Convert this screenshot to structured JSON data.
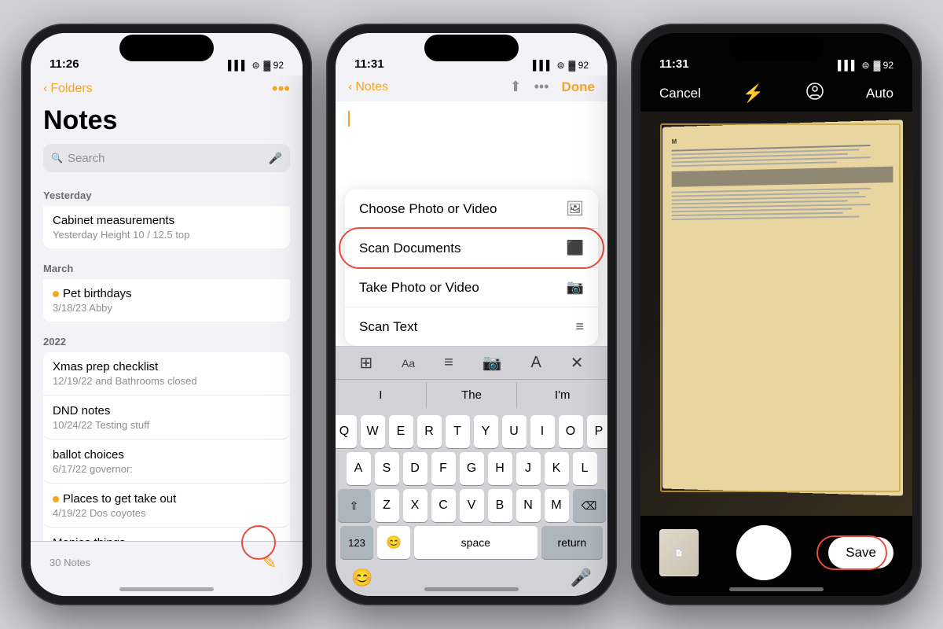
{
  "phone1": {
    "status": {
      "time": "11:26",
      "signal": "▌▌▌",
      "wifi": "WiFi",
      "battery": "92"
    },
    "nav": {
      "back_label": "Folders",
      "more_icon": "•••"
    },
    "title": "Notes",
    "search": {
      "placeholder": "Search"
    },
    "sections": [
      {
        "header": "Yesterday",
        "notes": [
          {
            "title": "Cabinet measurements",
            "subtitle": "Yesterday  Height 10 / 12.5 top",
            "shared": false
          }
        ]
      },
      {
        "header": "March",
        "notes": [
          {
            "title": "Pet birthdays",
            "subtitle": "3/18/23  Abby",
            "shared": true
          }
        ]
      },
      {
        "header": "2022",
        "notes": [
          {
            "title": "Xmas prep checklist",
            "subtitle": "12/19/22  and Bathrooms closed",
            "shared": false
          },
          {
            "title": "DND notes",
            "subtitle": "10/24/22  Testing stuff",
            "shared": false
          },
          {
            "title": "ballot choices",
            "subtitle": "6/17/22  governor:",
            "shared": false
          },
          {
            "title": "Places to get take out",
            "subtitle": "4/19/22  Dos coyotes",
            "shared": true
          },
          {
            "title": "Monies things",
            "subtitle": "",
            "shared": false
          }
        ]
      }
    ],
    "footer": {
      "count": "30 Notes",
      "compose_icon": "✏"
    }
  },
  "phone2": {
    "status": {
      "time": "11:31",
      "signal": "▌▌▌",
      "wifi": "WiFi",
      "battery": "92"
    },
    "nav": {
      "back_label": "Notes",
      "done_label": "Done"
    },
    "menu": {
      "items": [
        {
          "label": "Choose Photo or Video",
          "icon": "🖼",
          "highlighted": false
        },
        {
          "label": "Scan Documents",
          "icon": "⬛",
          "highlighted": true
        },
        {
          "label": "Take Photo or Video",
          "icon": "📷",
          "highlighted": false
        },
        {
          "label": "Scan Text",
          "icon": "≡",
          "highlighted": false
        }
      ]
    },
    "toolbar": {
      "icons": [
        "⊞",
        "Aa",
        "≡·",
        "📷",
        "A",
        "✕"
      ]
    },
    "predictive": [
      "I",
      "The",
      "I'm"
    ],
    "keyboard": {
      "row1": [
        "Q",
        "W",
        "E",
        "R",
        "T",
        "Y",
        "U",
        "I",
        "O",
        "P"
      ],
      "row2": [
        "A",
        "S",
        "D",
        "F",
        "G",
        "H",
        "J",
        "K",
        "L"
      ],
      "row3": [
        "Z",
        "X",
        "C",
        "V",
        "B",
        "N",
        "M"
      ],
      "row4_num": "123",
      "row4_space": "space",
      "row4_return": "return"
    }
  },
  "phone3": {
    "status": {
      "time": "11:31",
      "signal": "▌▌▌",
      "wifi": "WiFi",
      "battery": "92"
    },
    "camera_bar": {
      "cancel": "Cancel",
      "flash": "⚡",
      "face": "👤",
      "auto": "Auto"
    },
    "save_button": "Save"
  },
  "accent_color": "#f5a623",
  "danger_color": "#e74c3c"
}
